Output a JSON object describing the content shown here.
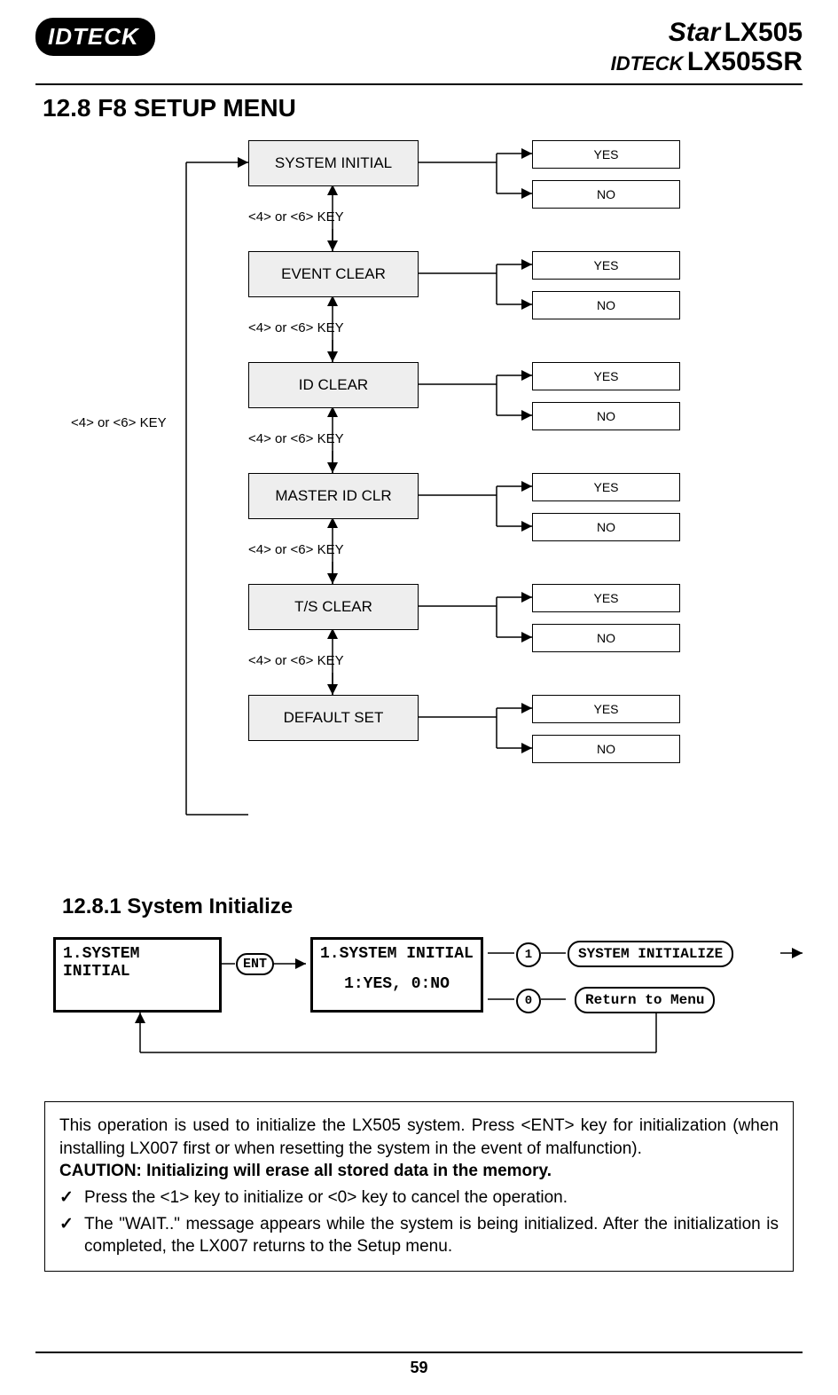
{
  "header": {
    "logo": "IDTECK",
    "model_star": "Star",
    "model_lx": "LX505",
    "model_idteck": "IDTECK",
    "model_lxsr": "LX505SR"
  },
  "section_title": "12.8 F8 SETUP MENU",
  "flow": {
    "loop_label": "<4> or <6> KEY",
    "items": [
      {
        "label": "SYSTEM INITIAL",
        "yes": "YES",
        "no": "NO",
        "nav": "<4> or <6> KEY"
      },
      {
        "label": "EVENT CLEAR",
        "yes": "YES",
        "no": "NO",
        "nav": "<4> or <6> KEY"
      },
      {
        "label": "ID CLEAR",
        "yes": "YES",
        "no": "NO",
        "nav": "<4> or <6> KEY"
      },
      {
        "label": "MASTER ID CLR",
        "yes": "YES",
        "no": "NO",
        "nav": "<4> or <6> KEY"
      },
      {
        "label": "T/S CLEAR",
        "yes": "YES",
        "no": "NO",
        "nav": "<4> or <6> KEY"
      },
      {
        "label": "DEFAULT SET",
        "yes": "YES",
        "no": "NO",
        "nav": ""
      }
    ]
  },
  "subsection_title": "12.8.1 System Initialize",
  "lcd": {
    "screen1": "1.SYSTEM INITIAL",
    "ent_key": "ENT",
    "screen2_line1": "1.SYSTEM INITIAL",
    "screen2_line2": "1:YES, 0:NO",
    "key1": "1",
    "key0": "0",
    "result1": "SYSTEM INITIALIZE",
    "result0": "Return to Menu"
  },
  "note": {
    "p1": "This operation is used to initialize the LX505 system. Press <ENT> key for initialization (when installing LX007 first or when resetting the system in the event of malfunction).",
    "caution": "CAUTION: Initializing will erase all stored data in the memory.",
    "b1": "Press the <1> key to initialize or <0> key to cancel the operation.",
    "b2": "The \"WAIT..\" message appears while the system is being initialized. After the initialization is completed, the LX007 returns to the Setup menu."
  },
  "page_number": "59"
}
